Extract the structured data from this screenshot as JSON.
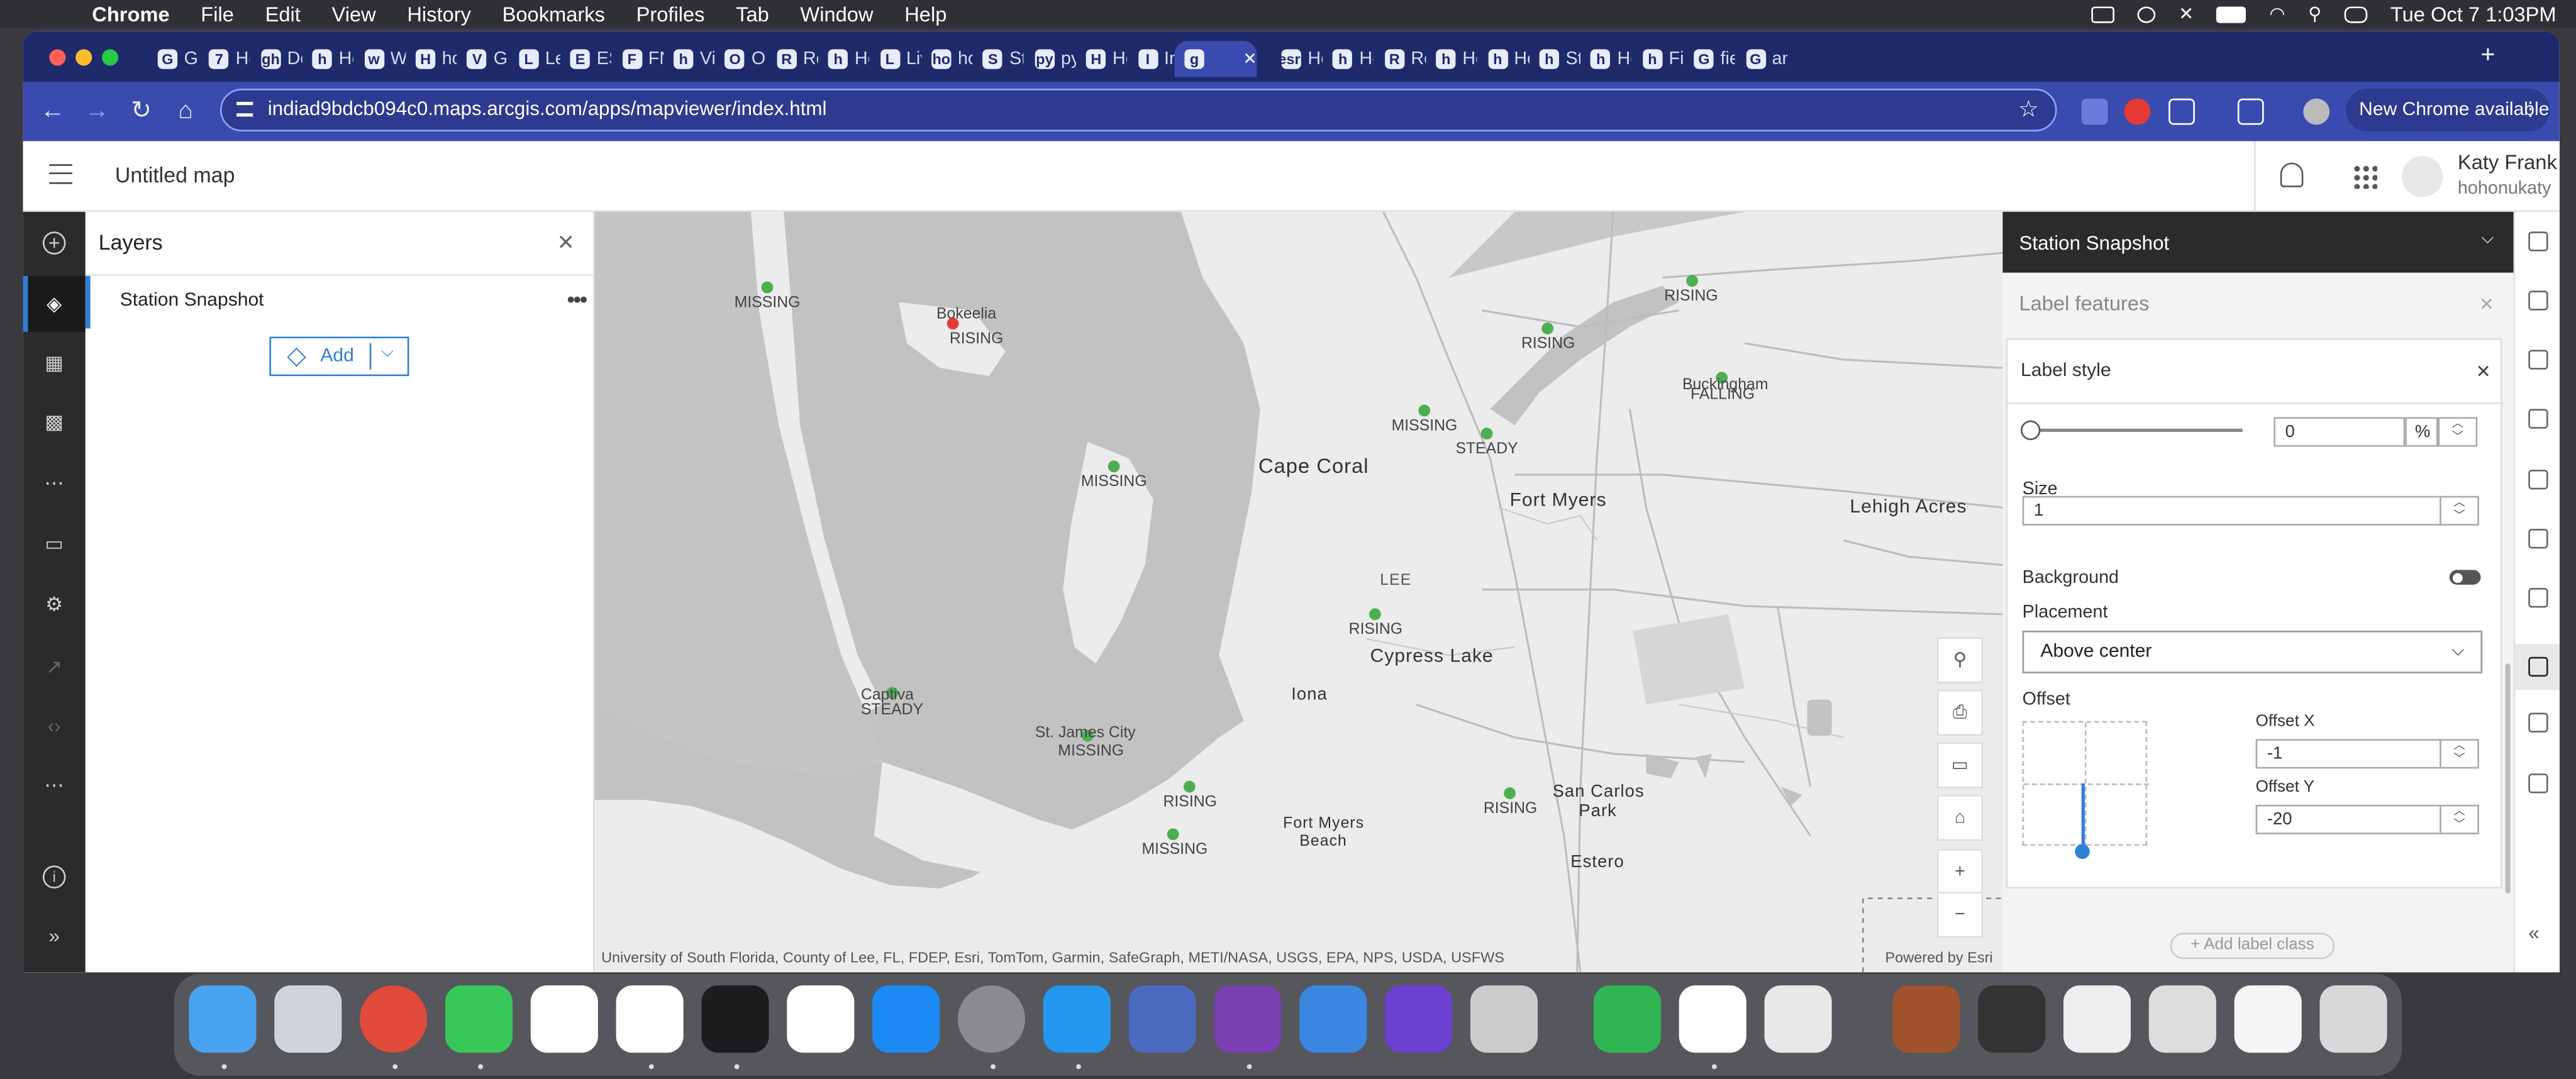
{
  "menubar": {
    "app": "Chrome",
    "items": [
      "File",
      "Edit",
      "View",
      "History",
      "Bookmarks",
      "Profiles",
      "Tab",
      "Window",
      "Help"
    ],
    "datetime": "Tue Oct 7  1:03PM"
  },
  "browser": {
    "tabs": [
      {
        "favicon": "G",
        "title": "Gr"
      },
      {
        "favicon": "7",
        "title": "Ho"
      },
      {
        "favicon": "gh",
        "title": "De"
      },
      {
        "favicon": "h",
        "title": "Ho"
      },
      {
        "favicon": "w",
        "title": "W"
      },
      {
        "favicon": "H",
        "title": "ho"
      },
      {
        "favicon": "V",
        "title": "Gl"
      },
      {
        "favicon": "L",
        "title": "Le"
      },
      {
        "favicon": "E",
        "title": "ES"
      },
      {
        "favicon": "F",
        "title": "FN"
      },
      {
        "favicon": "h",
        "title": "Vi"
      },
      {
        "favicon": "O",
        "title": "Ol"
      },
      {
        "favicon": "R",
        "title": "Re"
      },
      {
        "favicon": "h",
        "title": "Ho"
      },
      {
        "favicon": "L",
        "title": "Liv"
      },
      {
        "favicon": "ho",
        "title": "ho"
      },
      {
        "favicon": "S",
        "title": "St"
      },
      {
        "favicon": "py",
        "title": "py"
      },
      {
        "favicon": "H",
        "title": "Ho"
      },
      {
        "favicon": "I",
        "title": "Int"
      },
      {
        "favicon": "g",
        "title": ""
      },
      {
        "favicon": "esri",
        "title": "Ho"
      },
      {
        "favicon": "h",
        "title": "Ho"
      },
      {
        "favicon": "R",
        "title": "Re"
      },
      {
        "favicon": "h",
        "title": "Ho"
      },
      {
        "favicon": "h",
        "title": "Ho"
      },
      {
        "favicon": "h",
        "title": "St"
      },
      {
        "favicon": "h",
        "title": "Ho"
      },
      {
        "favicon": "h",
        "title": "Fi"
      },
      {
        "favicon": "G",
        "title": "fie"
      },
      {
        "favicon": "G",
        "title": "an"
      }
    ],
    "url": "indiad9bdcb094c0.maps.arcgis.com/apps/mapviewer/index.html",
    "new_chrome_label": "New Chrome available"
  },
  "app": {
    "map_title": "Untitled map",
    "user_name": "Katy Frank",
    "user_id": "hohonukaty"
  },
  "layers_panel": {
    "title": "Layers",
    "layer_name": "Station Snapshot",
    "add_label": "Add"
  },
  "map": {
    "cities": [
      {
        "name": "Cape Coral"
      },
      {
        "name": "Fort Myers"
      },
      {
        "name": "Lehigh Acres"
      },
      {
        "name": "Cypress Lake"
      },
      {
        "name": "Iona"
      },
      {
        "name": "San Carlos"
      },
      {
        "name": "Park"
      },
      {
        "name": "Estero"
      },
      {
        "name": "Fort Myers"
      },
      {
        "name": "Beach"
      },
      {
        "name": "LEE"
      },
      {
        "name": "Bokeelia"
      },
      {
        "name": "Captiva"
      },
      {
        "name": "St. James City"
      },
      {
        "name": "Buckingham"
      }
    ],
    "stations": [
      {
        "label": "MISSING",
        "color": "#4caf50"
      },
      {
        "label": "RISING",
        "color": "#e53935"
      },
      {
        "label": "MISSING",
        "color": "#4caf50"
      },
      {
        "label": "MISSING",
        "color": "#4caf50"
      },
      {
        "label": "STEADY",
        "color": "#4caf50"
      },
      {
        "label": "RISING",
        "color": "#4caf50"
      },
      {
        "label": "RISING",
        "color": "#4caf50"
      },
      {
        "label": "FALLING",
        "color": "#4caf50"
      },
      {
        "label": "RISING",
        "color": "#4caf50"
      },
      {
        "label": "STEADY",
        "color": "#4caf50"
      },
      {
        "label": "MISSING",
        "color": "#4caf50"
      },
      {
        "label": "RISING",
        "color": "#4caf50"
      },
      {
        "label": "MISSING",
        "color": "#4caf50"
      },
      {
        "label": "RISING",
        "color": "#4caf50"
      }
    ],
    "attribution": "University of South Florida, County of Lee, FL, FDEP, Esri, TomTom, Garmin, SafeGraph, METI/NASA, USGS, EPA, NPS, USDA, USFWS",
    "powered_by": "Powered by Esri"
  },
  "right_panel": {
    "header": "Station Snapshot",
    "section": "Label features",
    "card_title": "Label style",
    "rotation_value": "0",
    "rotation_unit": "%",
    "size_label": "Size",
    "size_value": "1",
    "background_label": "Background",
    "background_on": false,
    "placement_label": "Placement",
    "placement_value": "Above center",
    "offset_label": "Offset",
    "offset_x_label": "Offset X",
    "offset_x_value": "-1",
    "offset_y_label": "Offset Y",
    "offset_y_value": "-20",
    "add_label_class": "Add label class"
  },
  "colors": {
    "accent": "#2f7fd6",
    "tabstrip": "#1f2a6b",
    "toolbar": "#3a4bb0",
    "station_green": "#4caf50",
    "station_red": "#e53935"
  }
}
